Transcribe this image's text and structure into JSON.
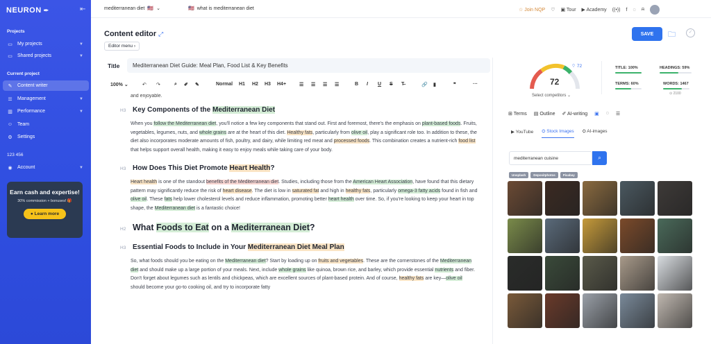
{
  "sidebar": {
    "logo": "NEURON",
    "projects_label": "Projects",
    "my_projects": "My projects",
    "shared_projects": "Shared projects",
    "current_project_label": "Current project",
    "content_writer": "Content writer",
    "management": "Management",
    "performance": "Performance",
    "team": "Team",
    "settings": "Settings",
    "account_number": "123 456",
    "account": "Account",
    "promo": {
      "title": "Earn cash and expertise!",
      "sub": "30% commission + bonuses! 🎁",
      "button": "Learn more"
    }
  },
  "topbar": {
    "crumb1": "mediterranean diet",
    "crumb2": "what is mediterranean diet",
    "join": "Join NQP",
    "tour": "Tour",
    "academy": "Academy"
  },
  "editor": {
    "title": "Content editor",
    "menu": "Editor menu",
    "save": "SAVE",
    "title_label": "Title",
    "title_value": "Mediterranean Diet Guide: Meal Plan, Food List & Key Benefits",
    "toolbar": {
      "zoom": "100%",
      "normal": "Normal",
      "h1": "H1",
      "h2": "H2",
      "h3": "H3",
      "h4": "H4+"
    },
    "frag": "and enjoyable.",
    "h3a_pre": "Key Components of the ",
    "h3a_hl": "Mediterranean Diet",
    "p1": [
      "When you ",
      "follow the Mediterranean diet",
      ", you'll notice a few key components that stand out. First and foremost, there's the emphasis on ",
      "plant-based foods",
      ". Fruits, vegetables, legumes, nuts, and ",
      "whole grains",
      " are at the heart of this diet. ",
      "Healthy fats",
      ", particularly from ",
      "olive oil",
      ", play a significant role too. In addition to these, the diet also incorporates moderate amounts of fish, poultry, and dairy, while limiting red meat and ",
      "processed foods",
      ". This combination creates a nutrient-rich ",
      "food list",
      " that helps support overall health, making it easy to enjoy meals while taking care of your body."
    ],
    "h3b_pre": "How Does This Diet Promote ",
    "h3b_hl": "Heart Health",
    "h3b_post": "?",
    "p2": [
      "Heart health",
      " is one of the standout ",
      "benefits of the Mediterranean diet",
      ". Studies, including those from the ",
      "American Heart Association",
      ", have found that this dietary pattern may significantly reduce the risk of ",
      "heart disease",
      ". The diet is low in ",
      "saturated fat",
      " and high in ",
      "healthy fats",
      ", particularly ",
      "omega-3 fatty acids",
      " found in fish and ",
      "olive oil",
      ". These ",
      "fats",
      " help lower cholesterol levels and reduce inflammation, promoting better ",
      "heart health",
      " over time. So, if you're looking to keep your heart in top shape, the ",
      "Mediterranean diet",
      " is a fantastic choice!"
    ],
    "h2_pre": "What ",
    "h2_hl1": "Foods to Eat",
    "h2_mid": " on a ",
    "h2_hl2": "Mediterranean Diet",
    "h2_post": "?",
    "h3c_pre": "Essential Foods to Include in Your ",
    "h3c_hl": "Mediterranean Diet Meal Plan",
    "p3": [
      "So, what foods should you be eating on the ",
      "Mediterranean diet",
      "? Start by loading up on ",
      "fruits and vegetables",
      ". These are the cornerstones of the ",
      "Mediterranean diet",
      " and should make up a large portion of your meals. Next, include ",
      "whole grains",
      " like quinoa, brown rice, and barley, which provide essential ",
      "nutrients",
      " and fiber. Don't forget about legumes such as lentils and chickpeas, which are excellent sources of plant-based protein. And of course, ",
      "healthy fats",
      " are key—",
      "olive oil",
      " should become your go-to cooking oil, and try to incorporate fatty"
    ]
  },
  "panel": {
    "score": "72",
    "target": "72",
    "select_competitors": "Select competitors",
    "stats": {
      "title": "TITLE: 100%",
      "headings": "HEADINGS: 59%",
      "terms": "TERMS: 60%",
      "words": "WORDS: 1467",
      "words_sub": "2100"
    },
    "stat_fill": {
      "title": 1.0,
      "headings": 0.59,
      "terms": 0.6,
      "words": 0.7
    },
    "tabs": {
      "terms": "Terms",
      "outline": "Outline",
      "ai_writing": "AI-writing"
    },
    "subtabs": {
      "youtube": "YouTube",
      "stock": "Stock Images",
      "ai_images": "AI-images"
    },
    "search_value": "mediterranean cuisine",
    "chips": [
      "Unsplash",
      "Depositphotos",
      "Pixabay"
    ]
  },
  "colors": {
    "sidebar": "#2f4ee0",
    "accent": "#2f73ee",
    "highlight_green": "#d4edd6",
    "highlight_orange": "#fbe5c5",
    "highlight_red": "#fad7d3",
    "thumbs": [
      "#6b4a34",
      "#3b2a22",
      "#8a6a3f",
      "#4a5860",
      "#3e3a38",
      "#7a8b4a",
      "#5a6a7a",
      "#c59a3a",
      "#7b4a2a",
      "#4a6a5a",
      "#2a2c2a",
      "#3a4a3a",
      "#5a5a4a",
      "#a89a8a",
      "#d8dce0",
      "#7a5a3a",
      "#6a3a2a",
      "#9aa0a8",
      "#7a8a9a",
      "#c0b8b0"
    ]
  }
}
